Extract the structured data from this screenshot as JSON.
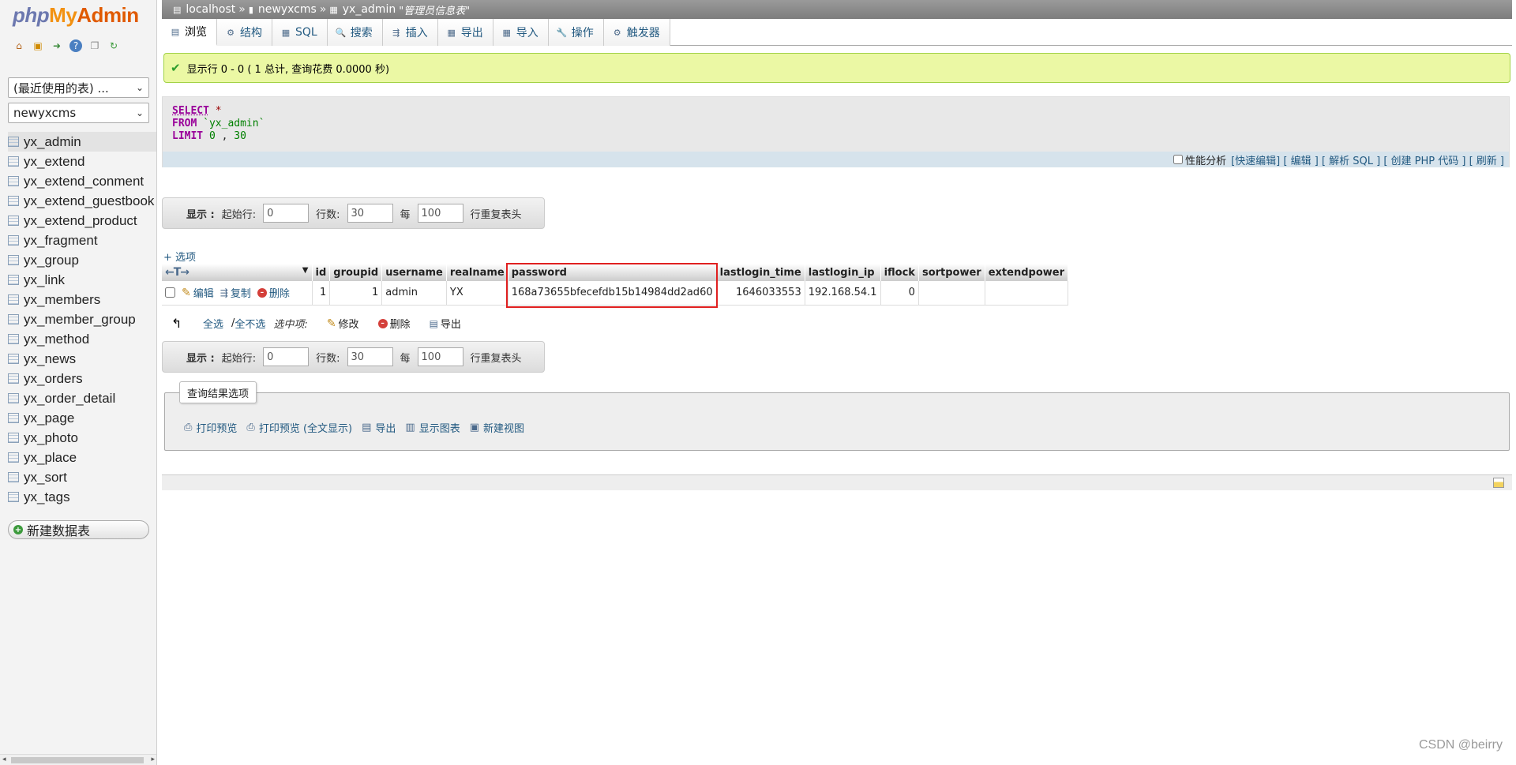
{
  "logo": {
    "php": "php",
    "my": "My",
    "admin": "Admin"
  },
  "sidebar": {
    "recent_select": "(最近使用的表) ...",
    "db_select": "newyxcms",
    "tables": [
      "yx_admin",
      "yx_extend",
      "yx_extend_conment",
      "yx_extend_guestbook",
      "yx_extend_product",
      "yx_fragment",
      "yx_group",
      "yx_link",
      "yx_members",
      "yx_member_group",
      "yx_method",
      "yx_news",
      "yx_orders",
      "yx_order_detail",
      "yx_page",
      "yx_photo",
      "yx_place",
      "yx_sort",
      "yx_tags"
    ],
    "active_table": "yx_admin",
    "new_table": "新建数据表"
  },
  "breadcrumb": {
    "server": "localhost",
    "database": "newyxcms",
    "table": "yx_admin",
    "comment": "\"管理员信息表\"",
    "sep": "»"
  },
  "tabs": [
    "浏览",
    "结构",
    "SQL",
    "搜索",
    "插入",
    "导出",
    "导入",
    "操作",
    "触发器"
  ],
  "success": {
    "text": "显示行 0 - 0 ( 1 总计, 查询花费 0.0000 秒)"
  },
  "sql": {
    "select_kw": "SELECT",
    "star": "*",
    "from_kw": "FROM",
    "table": "`yx_admin`",
    "limit_kw": "LIMIT",
    "limit_a": "0",
    "comma": ",",
    "limit_b": "30"
  },
  "sqlbar": {
    "profiling": "性能分析",
    "links": "[快速编辑] [ 编辑 ] [ 解析 SQL ] [ 创建 PHP 代码 ] [ 刷新 ]"
  },
  "nav": {
    "show": "显示 :",
    "start_label": "起始行:",
    "start": "0",
    "rows_label": "行数:",
    "rows": "30",
    "per_label": "每",
    "per": "100",
    "repeat": "行重复表头"
  },
  "options_link": "+ 选项",
  "table": {
    "headers": [
      "id",
      "groupid",
      "username",
      "realname",
      "password",
      "lastlogin_time",
      "lastlogin_ip",
      "iflock",
      "sortpower",
      "extendpower"
    ],
    "rows": [
      {
        "id": "1",
        "groupid": "1",
        "username": "admin",
        "realname": "YX",
        "password": "168a73655bfecefdb15b14984dd2ad60",
        "lastlogin_time": "1646033553",
        "lastlogin_ip": "192.168.54.1",
        "iflock": "0",
        "sortpower": "",
        "extendpower": ""
      }
    ],
    "actions": {
      "edit": "编辑",
      "copy": "复制",
      "delete": "删除"
    },
    "arrows": "←T→"
  },
  "bulk": {
    "check_all": "全选",
    "slash": " / ",
    "uncheck_all": "全不选",
    "selected": "选中项:",
    "edit": "修改",
    "delete": "删除",
    "export": "导出"
  },
  "result_options": {
    "legend": "查询结果选项",
    "items": [
      "打印预览",
      "打印预览 (全文显示)",
      "导出",
      "显示图表",
      "新建视图"
    ]
  },
  "watermark": "CSDN @beirry"
}
